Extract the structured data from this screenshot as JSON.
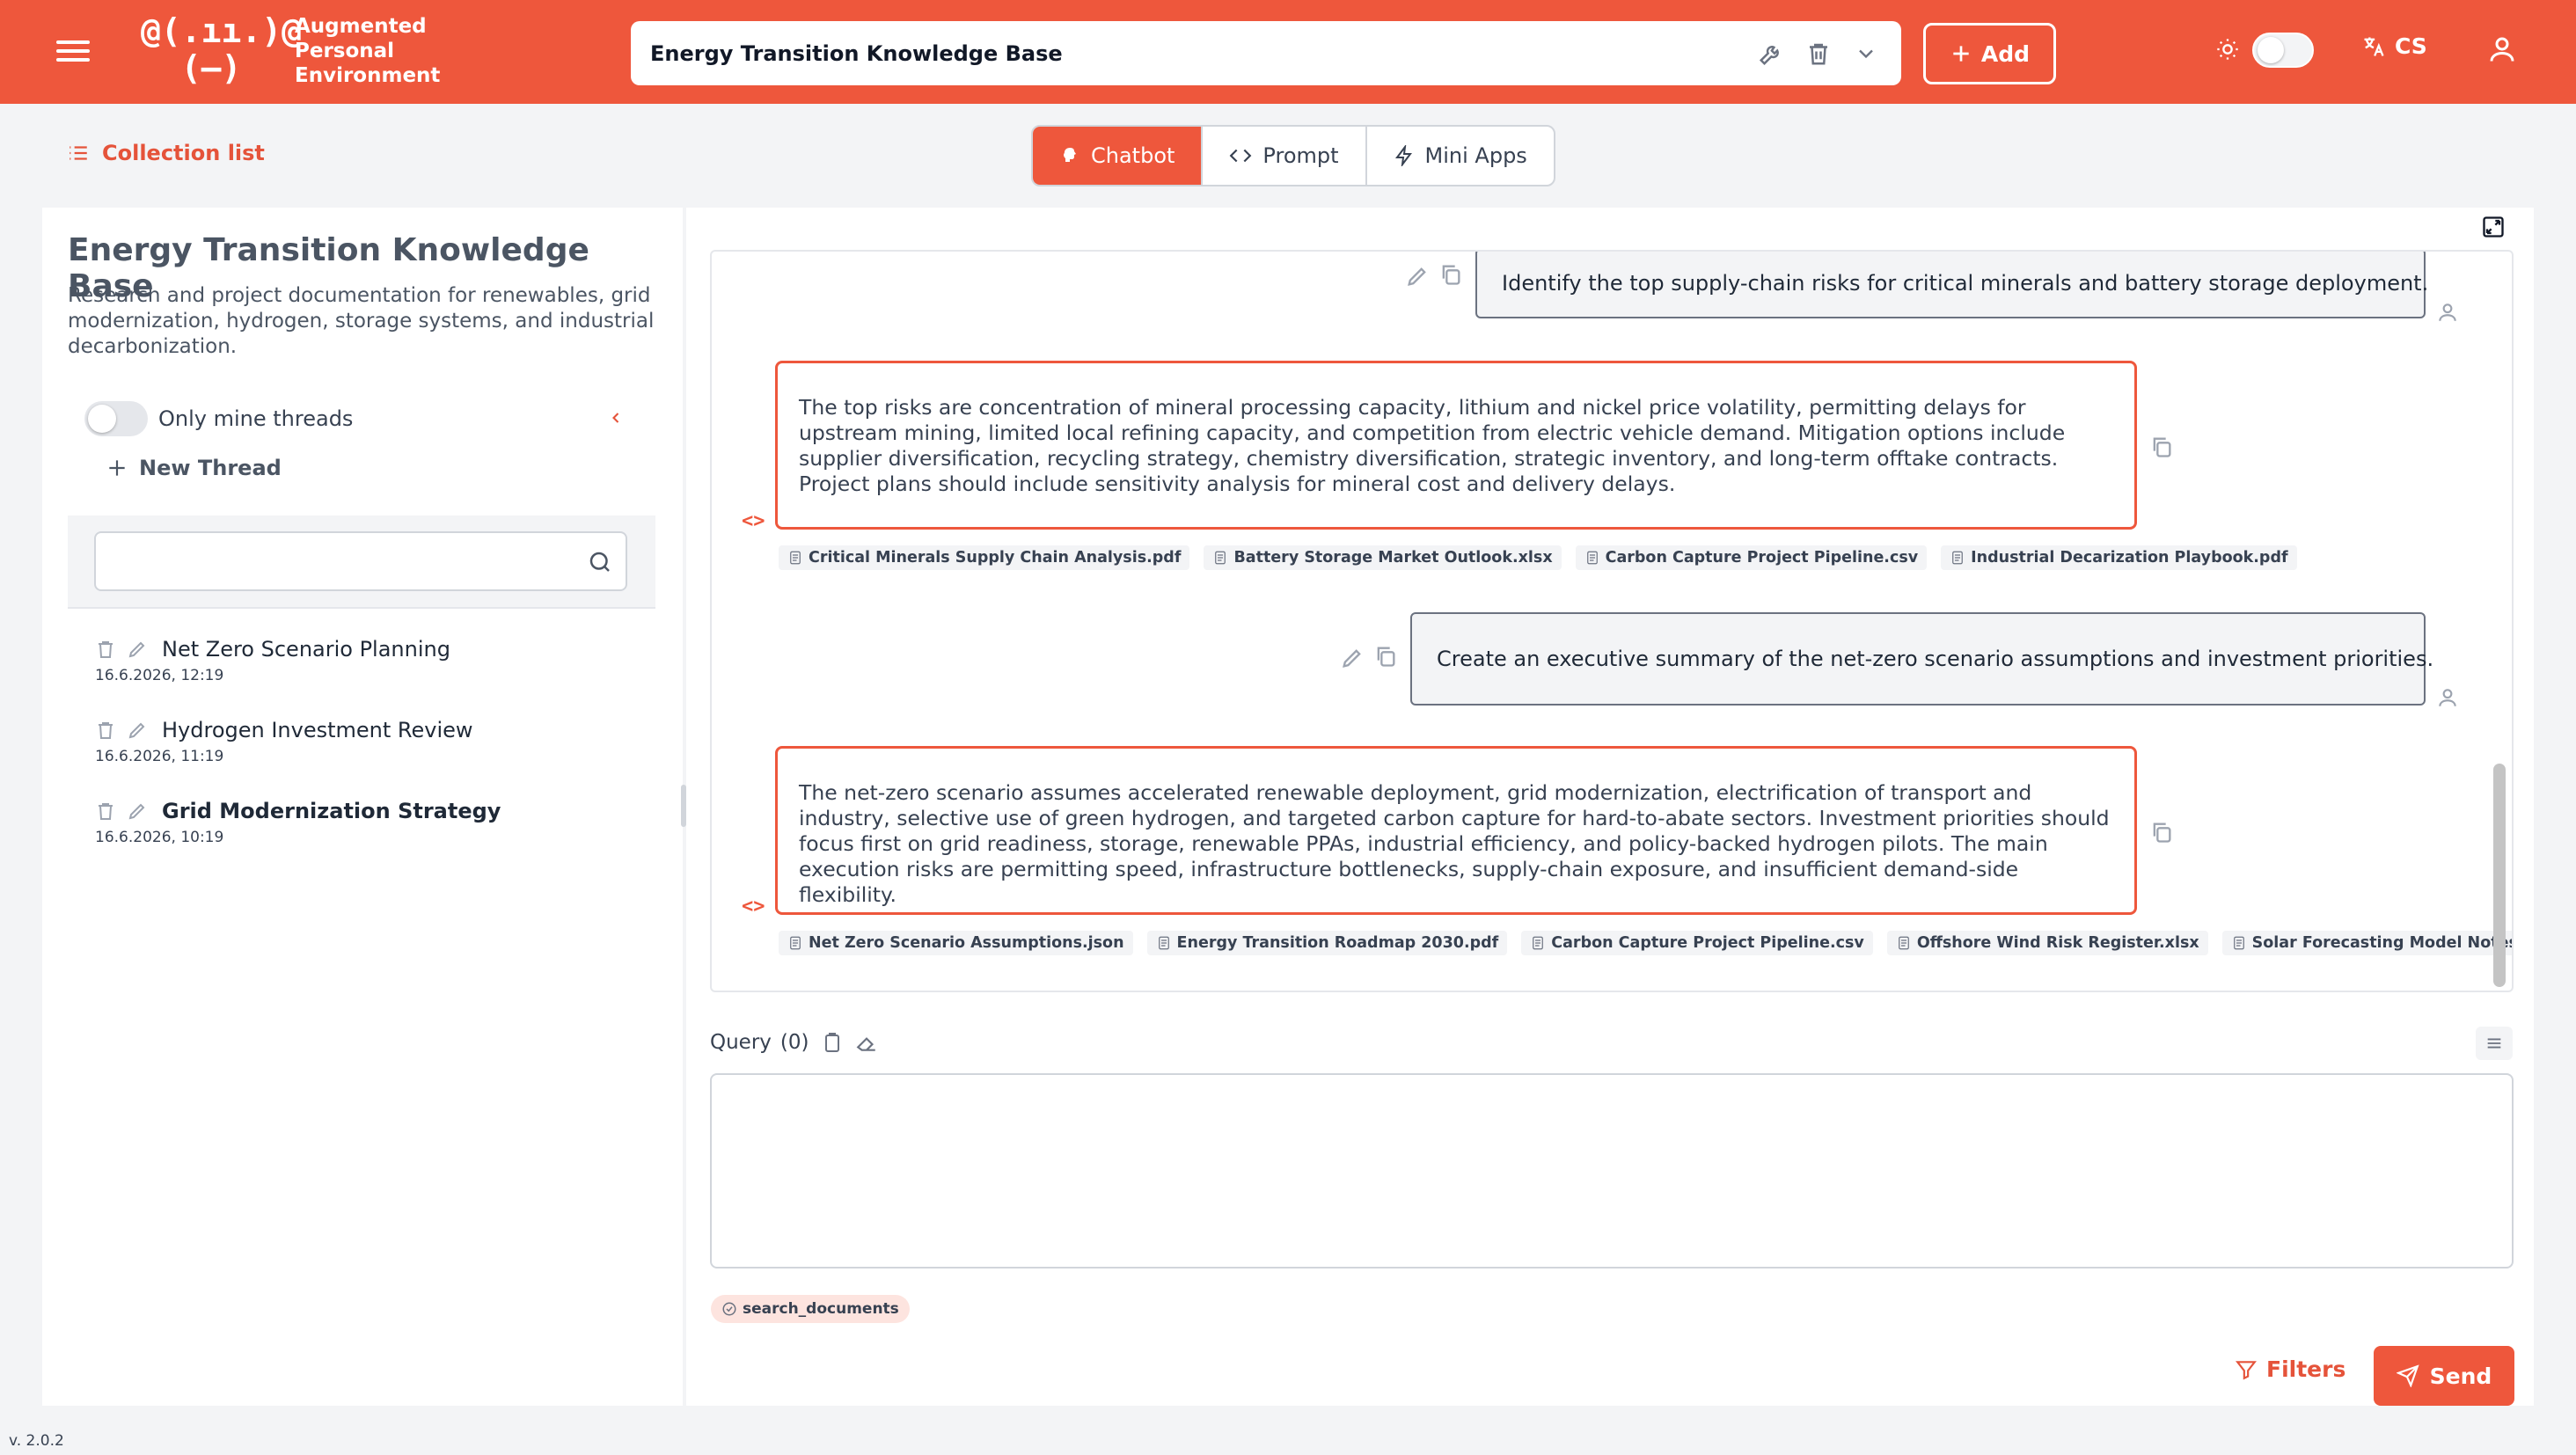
{
  "app": {
    "logo_mark": "@(.ıı.)@\n  (—)",
    "logo_line1": "Augmented",
    "logo_line2": "Personal",
    "logo_line3": "Environment",
    "version": "v. 2.0.2",
    "accent_color": "#ee573c"
  },
  "header": {
    "collection_name": "Energy Transition Knowledge Base",
    "add_label": "Add",
    "language": "CS"
  },
  "nav": {
    "collection_list_label": "Collection list",
    "tabs": [
      {
        "label": "Chatbot",
        "icon": "brain-icon"
      },
      {
        "label": "Prompt",
        "icon": "code-icon"
      },
      {
        "label": "Mini Apps",
        "icon": "lightning-icon"
      }
    ]
  },
  "sidebar": {
    "title": "Energy Transition Knowledge Base",
    "description": "Research and project documentation for renewables, grid modernization, hydrogen, storage systems, and industrial decarbonization.",
    "only_mine_label": "Only mine threads",
    "new_thread_label": "New Thread",
    "threads": [
      {
        "name": "Net Zero Scenario Planning",
        "date": "16.6.2026, 12:19"
      },
      {
        "name": "Hydrogen Investment Review",
        "date": "16.6.2026, 11:19"
      },
      {
        "name": "Grid Modernization Strategy",
        "date": "16.6.2026, 10:19"
      }
    ]
  },
  "chat": {
    "messages": [
      {
        "role": "user",
        "text": "Identify the top supply-chain risks for critical minerals and battery storage deployment."
      },
      {
        "role": "assistant",
        "text": "The top risks are concentration of mineral processing capacity, lithium and nickel price volatility, permitting delays for upstream mining, limited local refining capacity, and competition from electric vehicle demand. Mitigation options include supplier diversification, recycling strategy, chemistry diversification, strategic inventory, and long-term offtake contracts. Project plans should include sensitivity analysis for mineral cost and delivery delays.",
        "sources": [
          "Critical Minerals Supply Chain Analysis.pdf",
          "Battery Storage Market Outlook.xlsx",
          "Carbon Capture Project Pipeline.csv",
          "Industrial Decarization Playbook.pdf"
        ]
      },
      {
        "role": "user",
        "text": "Create an executive summary of the net-zero scenario assumptions and investment priorities."
      },
      {
        "role": "assistant",
        "text": "The net-zero scenario assumes accelerated renewable deployment, grid modernization, electrification of transport and industry, selective use of green hydrogen, and targeted carbon capture for hard-to-abate sectors. Investment priorities should focus first on grid readiness, storage, renewable PPAs, industrial efficiency, and policy-backed hydrogen pilots. The main execution risks are permitting speed, infrastructure bottlenecks, supply-chain exposure, and insufficient demand-side flexibility.",
        "sources": [
          "Net Zero Scenario Assumptions.json",
          "Energy Transition Roadmap 2030.pdf",
          "Carbon Capture Project Pipeline.csv",
          "Offshore Wind Risk Register.xlsx",
          "Solar Forecasting Model Notes.txt"
        ]
      }
    ]
  },
  "query": {
    "label": "Query",
    "count": "(0)",
    "value": "",
    "tool": "search_documents",
    "filters_label": "Filters",
    "send_label": "Send"
  }
}
